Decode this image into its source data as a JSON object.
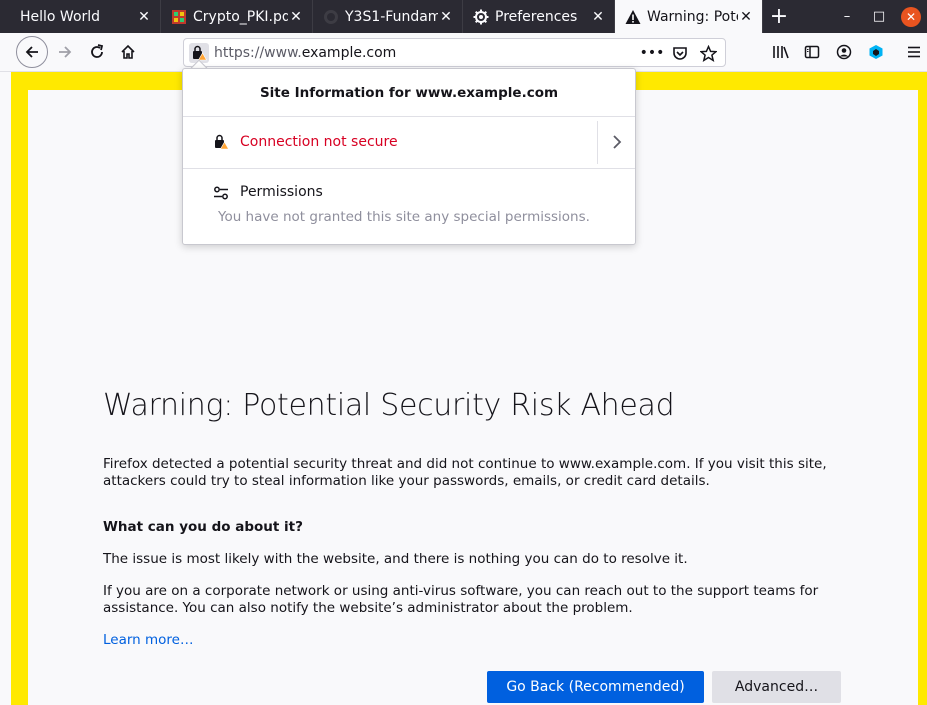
{
  "tabs": [
    {
      "label": "Hello World",
      "favicon": "none"
    },
    {
      "label": "Crypto_PKI.pd",
      "favicon": "document-icon"
    },
    {
      "label": "Y3S1-Fundam",
      "favicon": "github-icon"
    },
    {
      "label": "Preferences",
      "favicon": "gear-icon"
    },
    {
      "label": "Warning: Pote",
      "favicon": "warning-icon"
    }
  ],
  "tab_close_glyph": "✕",
  "new_tab_glyph": "+",
  "window": {
    "minimize": "–",
    "maximize": "□",
    "close": "✕"
  },
  "urlbar": {
    "scheme": "https://www.",
    "host": "example.com",
    "more": "•••"
  },
  "popup": {
    "header": "Site Information for www.example.com",
    "connection": "Connection not secure",
    "permissions_title": "Permissions",
    "permissions_desc": "You have not granted this site any special permissions."
  },
  "error": {
    "title": "Warning: Potential Security Risk Ahead",
    "intro": "Firefox detected a potential security threat and did not continue to www.example.com. If you visit this site, attackers could try to steal information like your passwords, emails, or credit card details.",
    "heading": "What can you do about it?",
    "p1": "The issue is most likely with the website, and there is nothing you can do to resolve it.",
    "p2": "If you are on a corporate network or using anti-virus software, you can reach out to the support teams for assistance. You can also notify the website’s administrator about the problem.",
    "learn_more": "Learn more…",
    "go_back": "Go Back (Recommended)",
    "advanced": "Advanced…"
  },
  "colors": {
    "tab_strip": "#2b2a33",
    "frame_border": "#ffe900",
    "primary_button": "#0060df",
    "insecure_text": "#d70022",
    "window_close": "#e95420"
  }
}
